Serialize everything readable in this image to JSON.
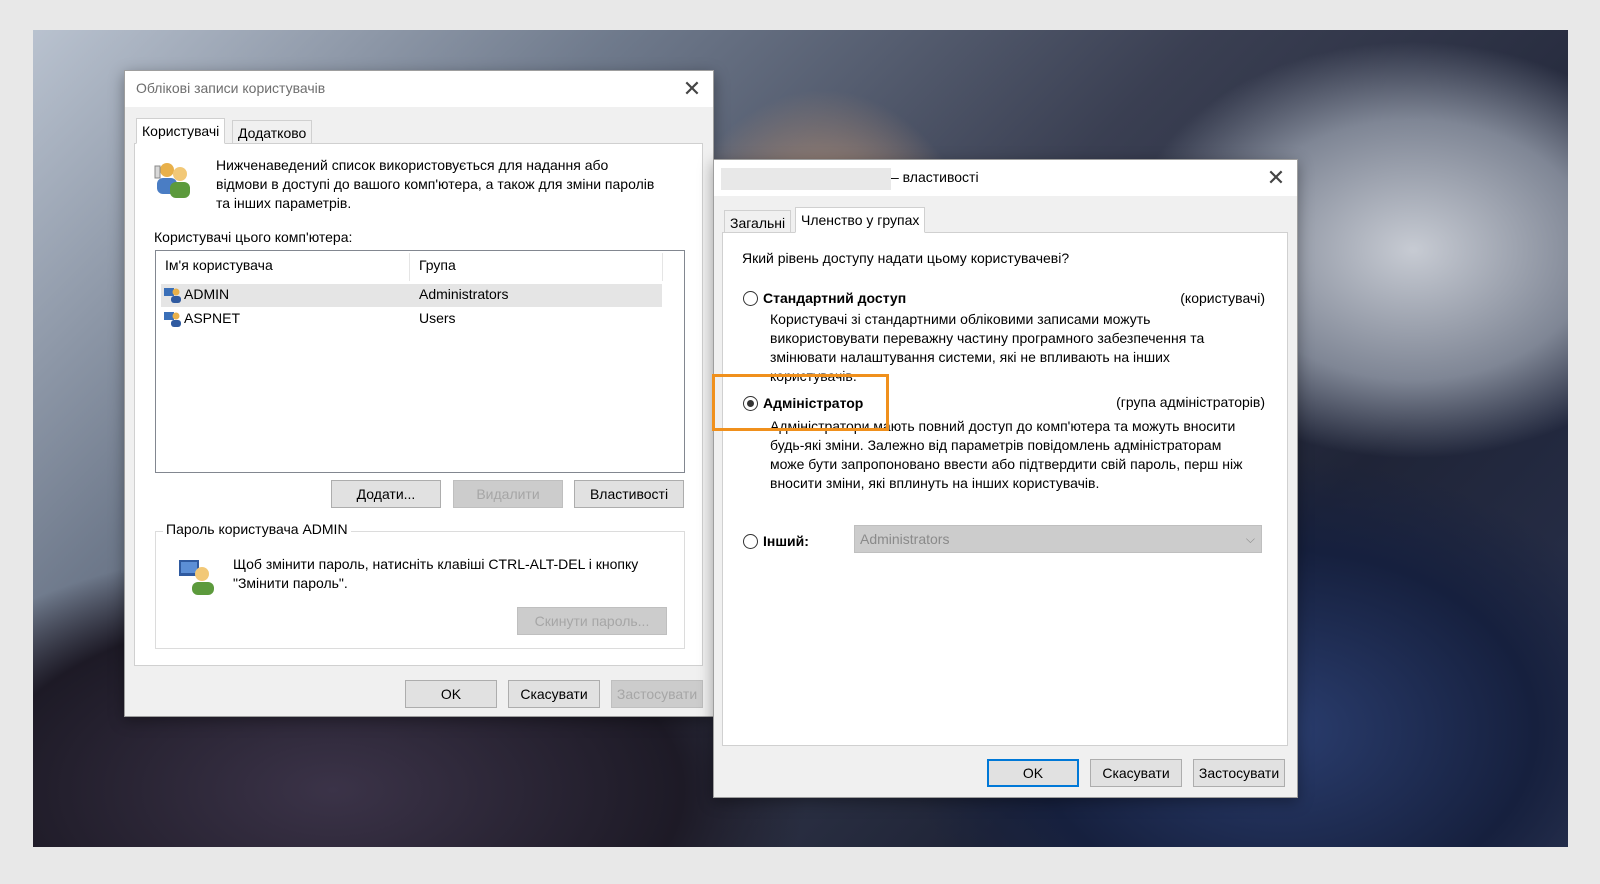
{
  "accounts_dialog": {
    "title": "Облікові записи користувачів",
    "tabs": [
      {
        "label": "Користувачі"
      },
      {
        "label": "Додатково"
      }
    ],
    "description": "Нижченаведений список використовується для надання або відмови в доступі до вашого комп'ютера, а також для зміни паролів та інших параметрів.",
    "list_label": "Користувачі цього комп'ютера:",
    "columns": {
      "name": "Ім'я користувача",
      "group": "Група"
    },
    "users": [
      {
        "name": "ADMIN",
        "group": "Administrators"
      },
      {
        "name": "ASPNET",
        "group": "Users"
      }
    ],
    "buttons": {
      "add": "Додати...",
      "remove": "Видалити",
      "properties": "Властивості"
    },
    "password_group_label": "Пароль користувача ADMIN",
    "password_text": "Щоб змінити пароль, натисніть клавіші CTRL-ALT-DEL і кнопку \"Змінити пароль\".",
    "reset_password": "Скинути пароль...",
    "ok": "OK",
    "cancel": "Скасувати",
    "apply": "Застосувати"
  },
  "properties_dialog": {
    "title": "– властивості",
    "tabs": [
      {
        "label": "Загальні"
      },
      {
        "label": "Членство у групах"
      }
    ],
    "question": "Який рівень доступу надати цьому користувачеві?",
    "options": {
      "standard": {
        "label": "Стандартний доступ",
        "group": "(користувачі)",
        "description": "Користувачі зі стандартними обліковими записами можуть використовувати переважну частину програмного забезпечення та змінювати налаштування системи, які не впливають на інших користувачів."
      },
      "admin": {
        "label": "Адміністратор",
        "group": "(група адміністраторів)",
        "description": "Адміністратори мають повний доступ до комп'ютера та можуть вносити будь-які зміни. Залежно від параметрів повідомлень адміністраторам може бути запропоновано ввести або підтвердити свій пароль, перш ніж вносити зміни, які вплинуть на інших користувачів.",
        "checked": true
      },
      "other": {
        "label": "Інший:",
        "selected_value": "Administrators"
      }
    },
    "ok": "OK",
    "cancel": "Скасувати",
    "apply": "Застосувати"
  },
  "colors": {
    "highlight": "#f0901c",
    "default_button_border": "#0078d7"
  }
}
